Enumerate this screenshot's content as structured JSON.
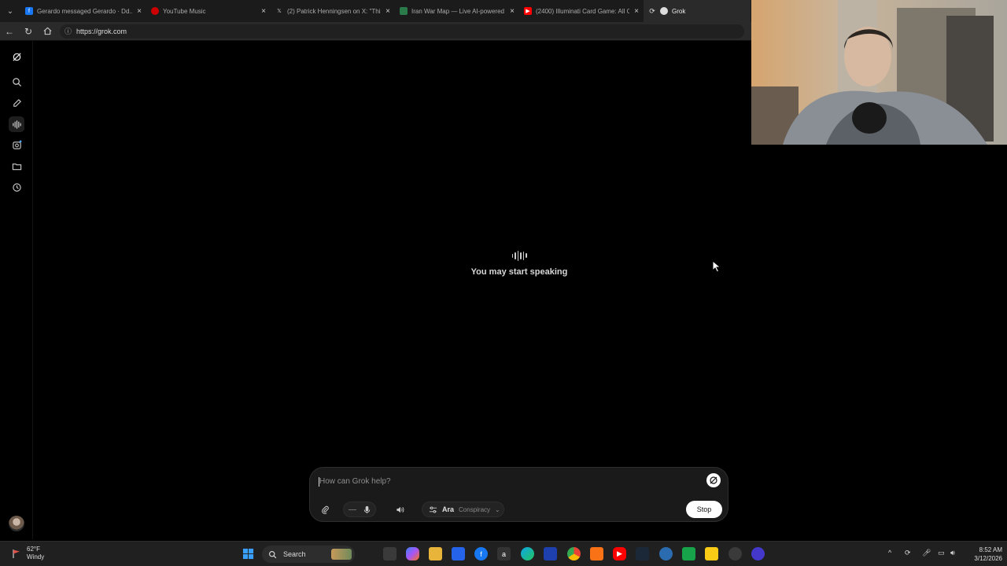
{
  "browser": {
    "tabs": [
      {
        "title": "Gerardo messaged Gerardo · Dd...",
        "favicon": "facebook-icon",
        "color": "#1877f2",
        "active": false
      },
      {
        "title": "YouTube Music",
        "favicon": "youtube-music-icon",
        "color": "#cc0000",
        "active": false
      },
      {
        "title": "(2) Patrick Henningsen on X: \"This",
        "favicon": "x-icon",
        "color": "#333333",
        "active": false
      },
      {
        "title": "Iran War Map — Live AI-powered",
        "favicon": "map-icon",
        "color": "#2a7a4a",
        "active": false
      },
      {
        "title": "(2400) Illuminati Card Game: All C",
        "favicon": "youtube-icon",
        "color": "#ff0000",
        "active": false
      },
      {
        "title": "Grok",
        "favicon": "grok-icon",
        "color": "#ffffff",
        "active": true
      }
    ],
    "url": "https://grok.com"
  },
  "main": {
    "status_text": "You may start speaking"
  },
  "composer": {
    "placeholder": "How can Grok help?",
    "voice_name": "Ara",
    "voice_mode": "Conspiracy",
    "stop_label": "Stop"
  },
  "taskbar": {
    "weather_temp": "62°F",
    "weather_desc": "Windy",
    "search_label": "Search",
    "time": "8:52 AM",
    "date": "3/12/2026"
  },
  "colors": {
    "background": "#000000",
    "composer_bg": "#1a1a1a",
    "taskbar_bg": "#202020"
  }
}
